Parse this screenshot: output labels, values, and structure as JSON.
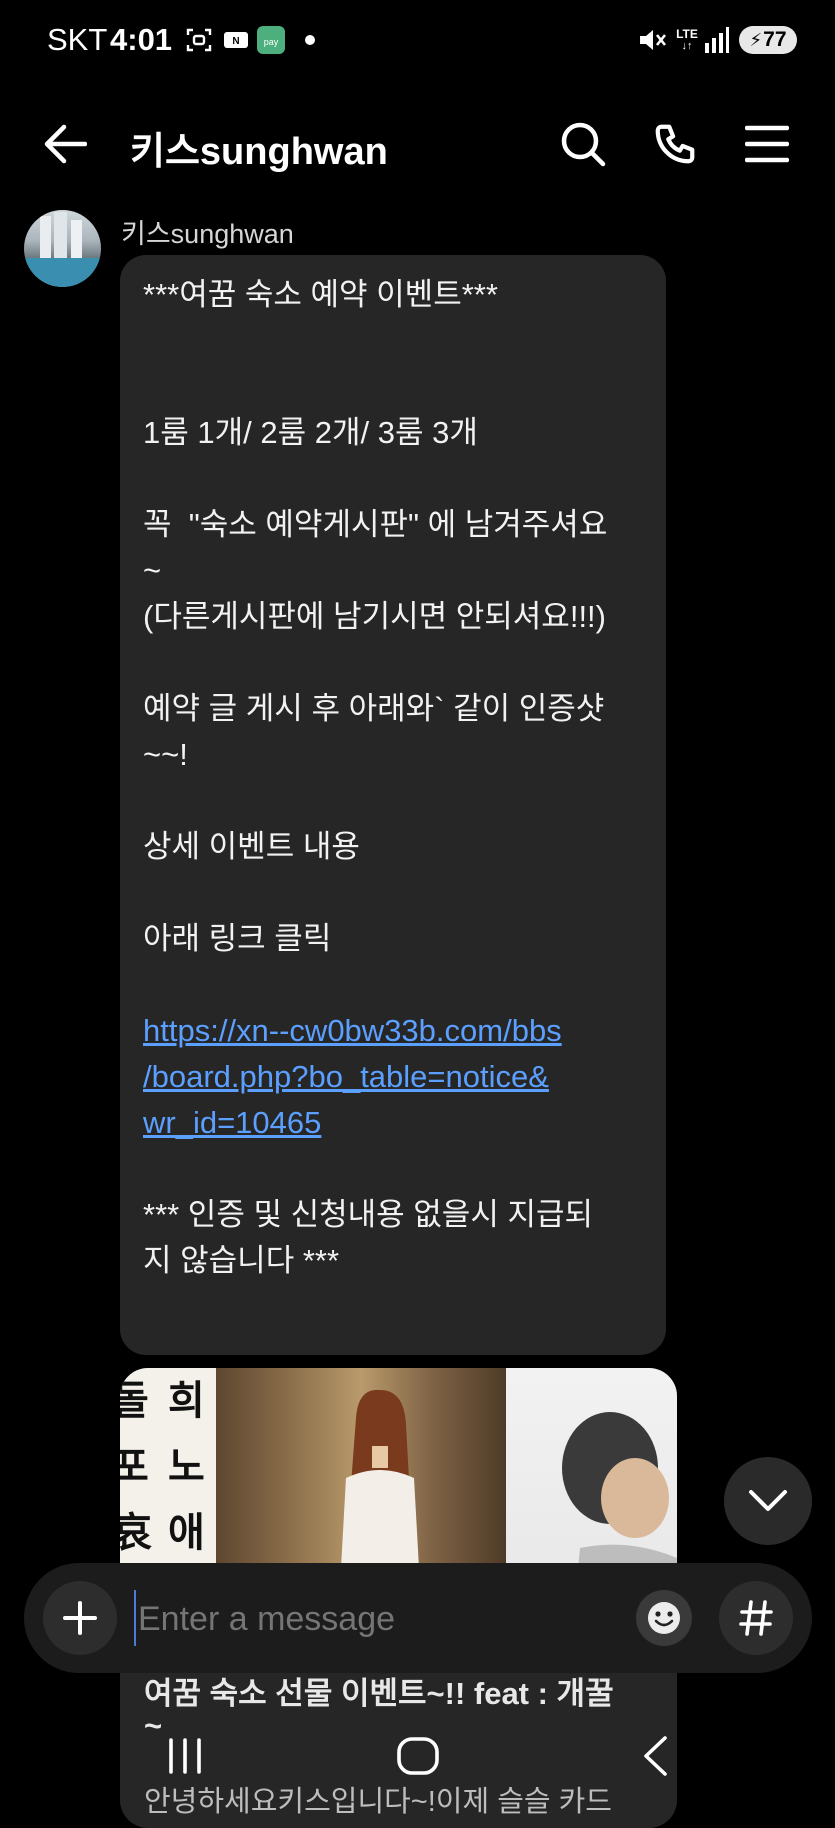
{
  "status_bar": {
    "carrier": "SKT",
    "time": "4:01",
    "network": "LTE",
    "battery": "77",
    "icons": [
      "screenshot-icon",
      "nfc-icon",
      "pay-app-icon",
      "notification-dot-icon",
      "mute-icon",
      "lte-icon",
      "signal-icon",
      "battery-charging-icon"
    ]
  },
  "header": {
    "title": "키스sunghwan",
    "icons": [
      "back-arrow-icon",
      "search-icon",
      "phone-icon",
      "menu-icon"
    ]
  },
  "message": {
    "sender_name": "키스sunghwan",
    "lines": [
      "***여꿈 숙소 예약 이벤트***",
      "1룸 1개/ 2룸 2개/ 3룸 3개",
      "꼭  \"숙소 예약게시판\" 에 남겨주셔요",
      "~",
      "(다른게시판에 남기시면 안되셔요!!!)",
      "예약 글 게시 후 아래와` 같이 인증샷",
      "~~!",
      "상세 이벤트 내용",
      "아래 링크 클릭",
      "*** 인증 및 신청내용 없을시 지급되",
      "지 않습니다 ***"
    ],
    "link_lines": [
      "https://xn--cw0bw33b.com/bbs",
      "/board.php?bo_table=notice&",
      "wr_id=10465"
    ]
  },
  "preview": {
    "image_text": [
      "희",
      "노",
      "애",
      "돌",
      "포",
      "哀"
    ],
    "title": "여꿈 숙소 선물 이벤트~!! feat : 개꿀",
    "title_cont": "~",
    "snippet": "안녕하세요키스입니다~!이제 슬슬 카드"
  },
  "input": {
    "placeholder": "Enter a message",
    "icons": [
      "plus-icon",
      "emoji-icon",
      "hashtag-icon"
    ]
  },
  "scroll_down": {
    "icon": "chevron-down-icon"
  },
  "nav": {
    "icons": [
      "recent-apps-icon",
      "home-icon",
      "back-icon"
    ]
  },
  "colors": {
    "background": "#000000",
    "bubble": "#262626",
    "link": "#5b9fff"
  }
}
